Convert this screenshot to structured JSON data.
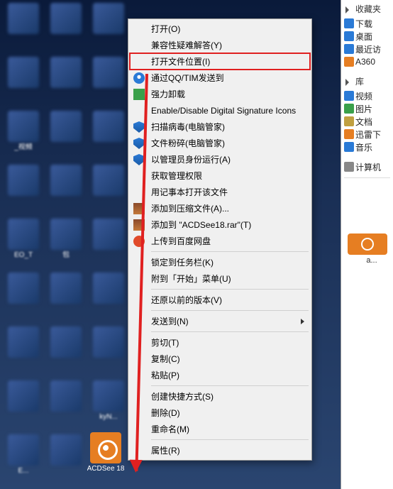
{
  "desktop": {
    "icons": [
      {
        "label": ""
      },
      {
        "label": ""
      },
      {
        "label": ""
      },
      {
        "label": ""
      },
      {
        "label": ""
      },
      {
        "label": ""
      },
      {
        "label": "_视频"
      },
      {
        "label": ""
      },
      {
        "label": ""
      },
      {
        "label": ""
      },
      {
        "label": ""
      },
      {
        "label": ""
      },
      {
        "label": "EO_T"
      },
      {
        "label": "包"
      },
      {
        "label": ""
      },
      {
        "label": ""
      },
      {
        "label": ""
      },
      {
        "label": ""
      },
      {
        "label": ""
      },
      {
        "label": ""
      },
      {
        "label": ""
      },
      {
        "label": ""
      },
      {
        "label": ""
      },
      {
        "label": "kyN..."
      },
      {
        "label": "E..."
      },
      {
        "label": ""
      }
    ],
    "acdsee_label": "ACDSee 18"
  },
  "context_menu": {
    "items": [
      {
        "label": "打开(O)",
        "icon": "",
        "hl": false
      },
      {
        "label": "兼容性疑难解答(Y)",
        "icon": "",
        "hl": false
      },
      {
        "label": "打开文件位置(I)",
        "icon": "",
        "hl": true
      },
      {
        "label": "通过QQ/TIM发送到",
        "icon": "qq",
        "hl": false
      },
      {
        "label": "强力卸载",
        "icon": "green",
        "hl": false
      },
      {
        "label": "Enable/Disable Digital Signature Icons",
        "icon": "",
        "hl": false
      },
      {
        "label": "扫描病毒(电脑管家)",
        "icon": "shield",
        "hl": false
      },
      {
        "label": "文件粉碎(电脑管家)",
        "icon": "shield",
        "hl": false
      },
      {
        "label": "以管理员身份运行(A)",
        "icon": "shield-y",
        "hl": false
      },
      {
        "label": "获取管理权限",
        "icon": "",
        "hl": false
      },
      {
        "label": "用记事本打开该文件",
        "icon": "",
        "hl": false
      },
      {
        "label": "添加到压缩文件(A)...",
        "icon": "rar",
        "hl": false
      },
      {
        "label": "添加到 \"ACDSee18.rar\"(T)",
        "icon": "rar",
        "hl": false
      },
      {
        "label": "上传到百度网盘",
        "icon": "cloud",
        "hl": false
      },
      {
        "sep": true
      },
      {
        "label": "锁定到任务栏(K)",
        "icon": "",
        "hl": false
      },
      {
        "label": "附到「开始」菜单(U)",
        "icon": "",
        "hl": false
      },
      {
        "sep": true
      },
      {
        "label": "还原以前的版本(V)",
        "icon": "",
        "hl": false
      },
      {
        "sep": true
      },
      {
        "label": "发送到(N)",
        "icon": "",
        "submenu": true,
        "hl": false
      },
      {
        "sep": true
      },
      {
        "label": "剪切(T)",
        "icon": "",
        "hl": false
      },
      {
        "label": "复制(C)",
        "icon": "",
        "hl": false
      },
      {
        "label": "粘贴(P)",
        "icon": "",
        "hl": false
      },
      {
        "sep": true
      },
      {
        "label": "创建快捷方式(S)",
        "icon": "",
        "hl": false
      },
      {
        "label": "删除(D)",
        "icon": "",
        "hl": false
      },
      {
        "label": "重命名(M)",
        "icon": "",
        "hl": false
      },
      {
        "sep": true
      },
      {
        "label": "属性(R)",
        "icon": "",
        "hl": false
      }
    ]
  },
  "sidebar": {
    "favorites": {
      "header": "收藏夹",
      "items": [
        {
          "label": "下载",
          "color": "#2a7ad6"
        },
        {
          "label": "桌面",
          "color": "#2a7ad6"
        },
        {
          "label": "最近访",
          "color": "#2a7ad6"
        },
        {
          "label": "A360",
          "color": "#e67e22"
        }
      ]
    },
    "libraries": {
      "header": "库",
      "items": [
        {
          "label": "视频",
          "color": "#2a7ad6"
        },
        {
          "label": "图片",
          "color": "#3aa04a"
        },
        {
          "label": "文档",
          "color": "#c0a040"
        },
        {
          "label": "迅雷下",
          "color": "#e67e22"
        },
        {
          "label": "音乐",
          "color": "#2a7ad6"
        }
      ]
    },
    "computer": {
      "label": "计算机"
    },
    "acd_label": "a..."
  }
}
